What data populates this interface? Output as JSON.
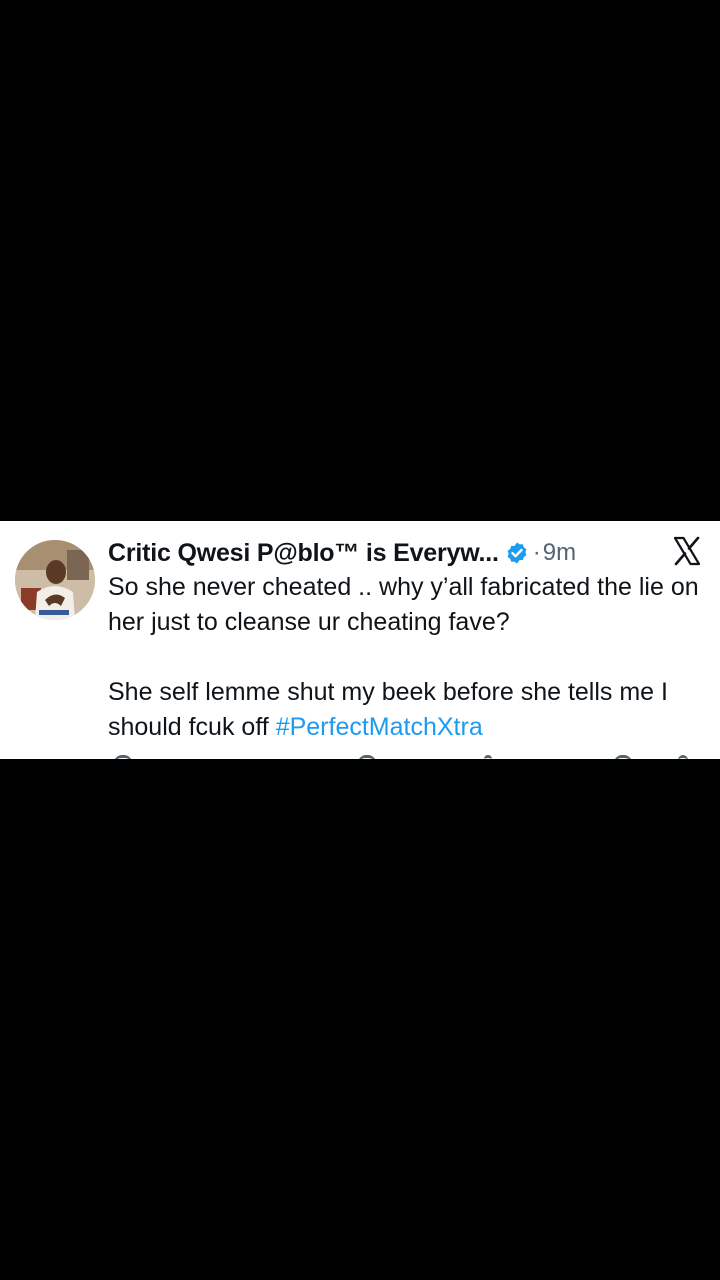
{
  "tweet": {
    "display_name": "Critic Qwesi P@blo™ is Everyw...",
    "dot": "·",
    "timestamp": "9m",
    "paragraph1": "So she never cheated .. why y’all fabricated the lie on her just to cleanse ur cheating fave?",
    "paragraph2_text": "She self lemme shut my beek before she tells me I should fcuk off ",
    "hashtag": "#PerfectMatchXtra",
    "verified_color": "#1d9bf0",
    "hashtag_color": "#1d9bf0",
    "avatar_icon": "profile-photo",
    "brand_icon": "x-logo-icon"
  }
}
